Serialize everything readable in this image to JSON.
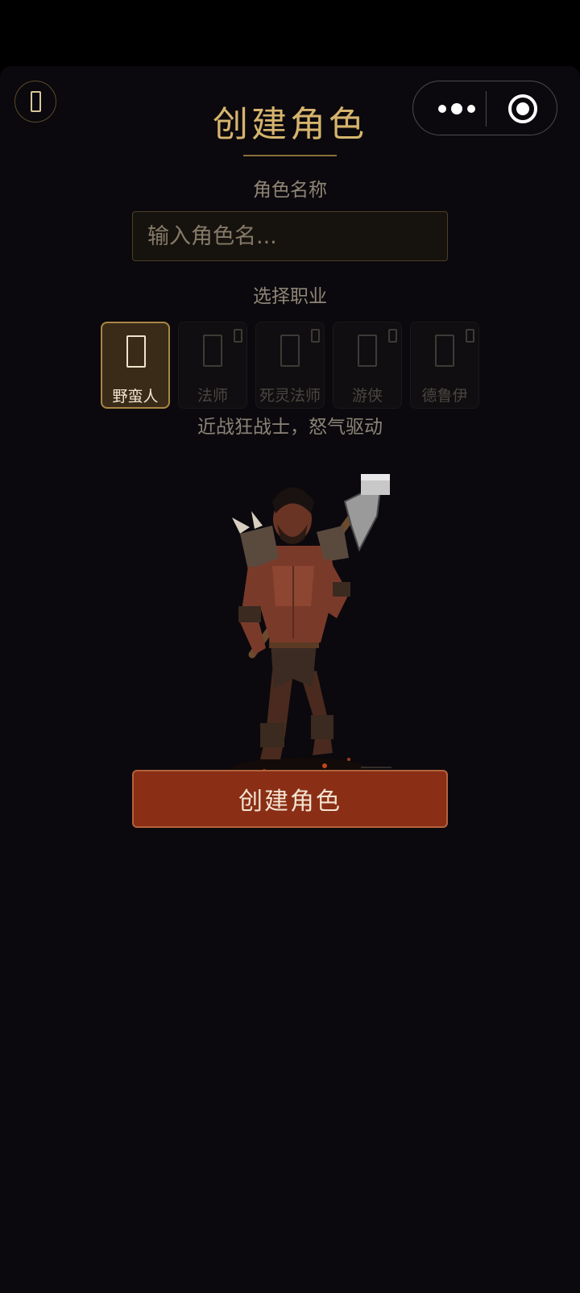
{
  "header": {
    "title": "创建角色",
    "back_icon": "back-icon",
    "menu_icon": "more-dots-icon",
    "close_icon": "target-circle-icon"
  },
  "form": {
    "name_label": "角色名称",
    "name_placeholder": "输入角色名...",
    "name_value": "",
    "class_label": "选择职业",
    "classes": [
      {
        "name": "野蛮人",
        "selected": true,
        "locked": false
      },
      {
        "name": "法师",
        "selected": false,
        "locked": true
      },
      {
        "name": "死灵法师",
        "selected": false,
        "locked": true
      },
      {
        "name": "游侠",
        "selected": false,
        "locked": true
      },
      {
        "name": "德鲁伊",
        "selected": false,
        "locked": true
      }
    ],
    "class_description": "近战狂战士，怒气驱动",
    "submit_label": "创建角色"
  },
  "colors": {
    "background": "#0b090d",
    "gold": "#d6b46e",
    "button": "#8a2e16"
  }
}
